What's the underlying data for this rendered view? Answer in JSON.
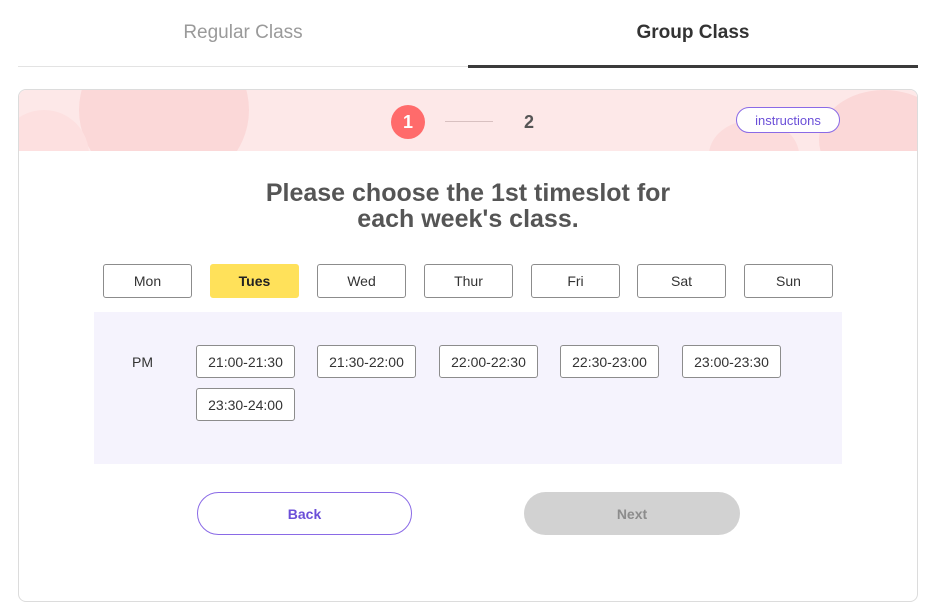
{
  "tabs": [
    {
      "label": "Regular Class",
      "active": false
    },
    {
      "label": "Group Class",
      "active": true
    }
  ],
  "stepper": {
    "steps": [
      "1",
      "2"
    ],
    "current": "1",
    "instructions_label": "instructions"
  },
  "title": {
    "line1": "Please choose the 1st timeslot for",
    "line2": "each week's class."
  },
  "days": [
    "Mon",
    "Tues",
    "Wed",
    "Thur",
    "Fri",
    "Sat",
    "Sun"
  ],
  "selected_day": "Tues",
  "timeslots": {
    "period_label": "PM",
    "slots": [
      "21:00-21:30",
      "21:30-22:00",
      "22:00-22:30",
      "22:30-23:00",
      "23:00-23:30",
      "23:30-24:00"
    ]
  },
  "actions": {
    "back_label": "Back",
    "next_label": "Next"
  },
  "colors": {
    "accent_purple": "#6b4fd8",
    "selected_day": "#ffe15a",
    "step_active": "#ff6b6b",
    "banner": "#fde8e8",
    "slots_panel": "#f5f3fd",
    "next_disabled": "#d2d2d2"
  }
}
